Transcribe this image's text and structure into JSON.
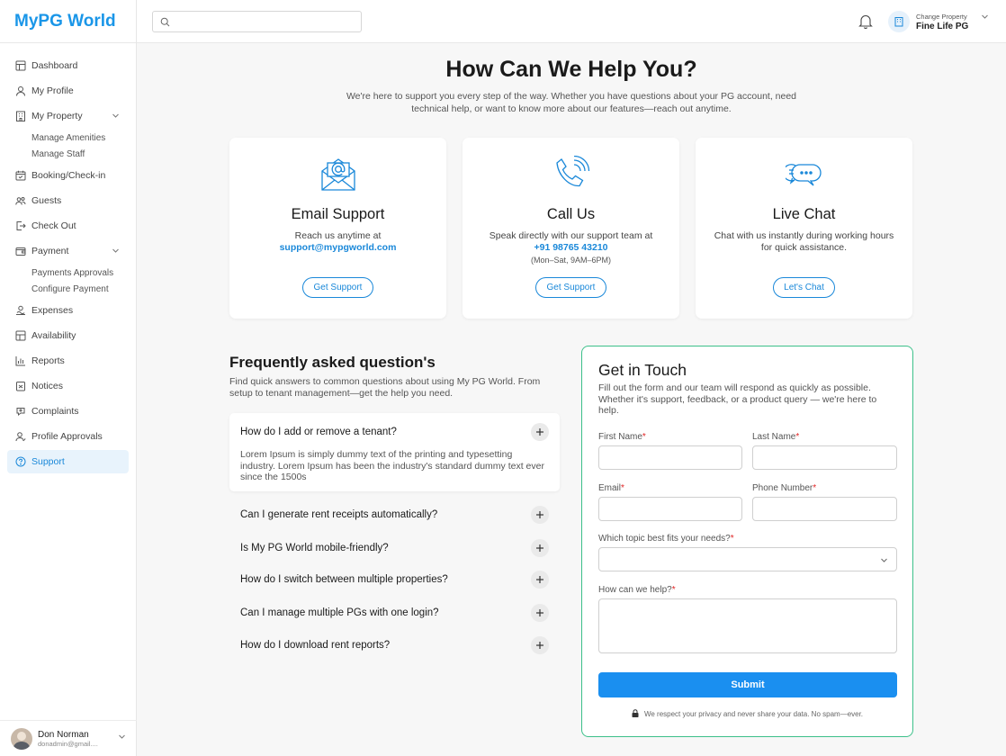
{
  "app": {
    "logo": "MyPG World"
  },
  "sidebar": {
    "items": [
      {
        "label": "Dashboard",
        "icon": "dashboard-icon"
      },
      {
        "label": "My Profile",
        "icon": "user-icon"
      },
      {
        "label": "My Property",
        "icon": "building-icon",
        "expanded": true
      },
      {
        "label": "Booking/Check-in",
        "icon": "calendar-icon"
      },
      {
        "label": "Guests",
        "icon": "users-icon"
      },
      {
        "label": "Check Out",
        "icon": "logout-icon"
      },
      {
        "label": "Payment",
        "icon": "wallet-icon",
        "expanded": true
      },
      {
        "label": "Expenses",
        "icon": "money-icon"
      },
      {
        "label": "Availability",
        "icon": "grid-icon"
      },
      {
        "label": "Reports",
        "icon": "bar-chart-icon"
      },
      {
        "label": "Notices",
        "icon": "notice-icon"
      },
      {
        "label": "Complaints",
        "icon": "complaint-icon"
      },
      {
        "label": "Profile Approvals",
        "icon": "user-check-icon"
      },
      {
        "label": "Support",
        "icon": "help-icon",
        "active": true
      }
    ],
    "property_sub": [
      "Manage Amenities",
      "Manage Staff"
    ],
    "payment_sub": [
      "Payments Approvals",
      "Configure Payment"
    ],
    "user": {
      "name": "Don Norman",
      "email": "donadmin@gmail...."
    }
  },
  "header": {
    "search_placeholder": "",
    "change_property_label": "Change Property",
    "property_name": "Fine Life PG"
  },
  "hero": {
    "title": "How Can We Help You?",
    "subtitle": "We're here to support you every step of the way. Whether you have questions about your PG account, need technical help, or want to know more about our features—reach out anytime."
  },
  "cards": [
    {
      "title": "Email Support",
      "desc": "Reach us anytime at",
      "link": "support@mypgworld.com",
      "button": "Get Support",
      "icon": "email-icon"
    },
    {
      "title": "Call Us",
      "desc": "Speak directly with our support team at",
      "link": "+91 98765 43210",
      "hours": "(Mon–Sat, 9AM–6PM)",
      "button": "Get Support",
      "icon": "phone-icon"
    },
    {
      "title": "Live Chat",
      "desc": "Chat with us instantly during working hours for quick assistance.",
      "button": "Let's Chat",
      "icon": "chat-icon"
    }
  ],
  "faq": {
    "title": "Frequently asked question's",
    "subtitle": "Find quick answers to common questions about using My PG World. From setup to tenant management—get the help you need.",
    "items": [
      {
        "q": "How do I add or remove a tenant?",
        "a": "Lorem Ipsum is simply dummy text of the printing and typesetting industry. Lorem Ipsum has been the industry's standard dummy text ever since the 1500s"
      },
      {
        "q": "Can I generate rent receipts automatically?"
      },
      {
        "q": "Is My PG World mobile-friendly?"
      },
      {
        "q": "How do I switch between multiple properties?"
      },
      {
        "q": "Can I manage multiple PGs with one login?"
      },
      {
        "q": "How do I download rent reports?"
      }
    ]
  },
  "form": {
    "title": "Get in Touch",
    "subtitle": "Fill out the form and our team will respond as quickly as possible. Whether it's support, feedback, or a product query — we're here to help.",
    "first_name": "First Name",
    "last_name": "Last Name",
    "email": "Email",
    "phone": "Phone Number",
    "topic": "Which topic best fits your needs?",
    "help": "How can we help?",
    "required_mark": "*",
    "submit": "Submit",
    "privacy": "We respect your privacy and never share your data. No spam—ever."
  },
  "colors": {
    "accent": "#1a88d9",
    "form_border": "#3cc08a",
    "submit": "#1a8ff0",
    "required": "#e02424"
  }
}
